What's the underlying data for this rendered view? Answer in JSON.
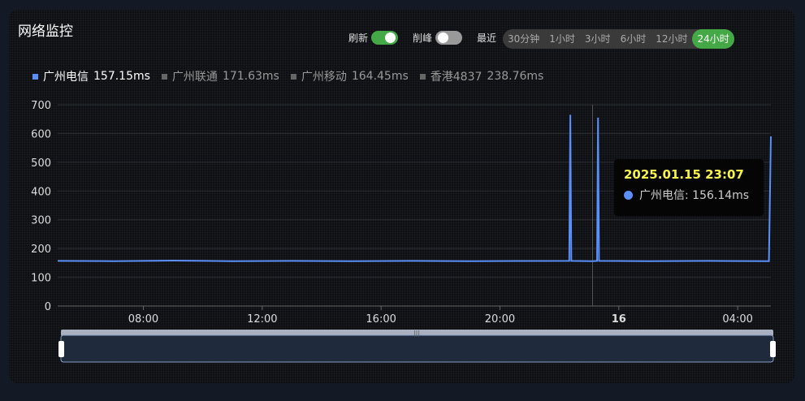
{
  "header": {
    "title": "网络监控",
    "refresh_label": "刷新",
    "refresh_on": true,
    "peak_label": "削峰",
    "peak_on": false,
    "recent_label": "最近",
    "ranges": [
      "30分钟",
      "1小时",
      "3小时",
      "6小时",
      "12小时",
      "24小时"
    ],
    "active_range": "24小时"
  },
  "legend": [
    {
      "name": "广州电信",
      "value": "157.15ms",
      "active": true
    },
    {
      "name": "广州联通",
      "value": "171.63ms",
      "active": false
    },
    {
      "name": "广州移动",
      "value": "164.45ms",
      "active": false
    },
    {
      "name": "香港4837",
      "value": "238.76ms",
      "active": false
    }
  ],
  "tooltip": {
    "time": "2025.01.15 23:07",
    "label": "广州电信: 156.14ms"
  },
  "colors": {
    "series": "#5b8ff9",
    "accent": "#43a845",
    "tooltip_title": "#f6f34a"
  },
  "chart_data": {
    "type": "line",
    "ylim": [
      0,
      700
    ],
    "yticks": [
      0,
      100,
      200,
      300,
      400,
      500,
      600,
      700
    ],
    "xrange": [
      "2025-01-15 05:07",
      "2025-01-16 05:07"
    ],
    "xticks": [
      {
        "t": "2025-01-15 08:00",
        "label": "08:00"
      },
      {
        "t": "2025-01-15 12:00",
        "label": "12:00"
      },
      {
        "t": "2025-01-15 16:00",
        "label": "16:00"
      },
      {
        "t": "2025-01-15 20:00",
        "label": "20:00"
      },
      {
        "t": "2025-01-16 00:00",
        "label": "16",
        "bold": true
      },
      {
        "t": "2025-01-16 04:00",
        "label": "04:00"
      }
    ],
    "crosshair": "2025-01-15 23:07",
    "series": [
      {
        "name": "广州电信",
        "points": [
          [
            "2025-01-15 05:07",
            157
          ],
          [
            "2025-01-15 07:00",
            156
          ],
          [
            "2025-01-15 09:00",
            158
          ],
          [
            "2025-01-15 11:00",
            156
          ],
          [
            "2025-01-15 13:00",
            157
          ],
          [
            "2025-01-15 15:00",
            156
          ],
          [
            "2025-01-15 17:00",
            157
          ],
          [
            "2025-01-15 19:00",
            156
          ],
          [
            "2025-01-15 22:20",
            157
          ],
          [
            "2025-01-15 22:22",
            665
          ],
          [
            "2025-01-15 22:24",
            157
          ],
          [
            "2025-01-15 23:07",
            156.14
          ],
          [
            "2025-01-15 23:16",
            157
          ],
          [
            "2025-01-15 23:18",
            655
          ],
          [
            "2025-01-15 23:20",
            157
          ],
          [
            "2025-01-16 01:00",
            156
          ],
          [
            "2025-01-16 03:00",
            157
          ],
          [
            "2025-01-16 05:03",
            156
          ],
          [
            "2025-01-16 05:07",
            590
          ]
        ]
      }
    ]
  },
  "zoom_slider": {
    "start": 0,
    "end": 100
  }
}
